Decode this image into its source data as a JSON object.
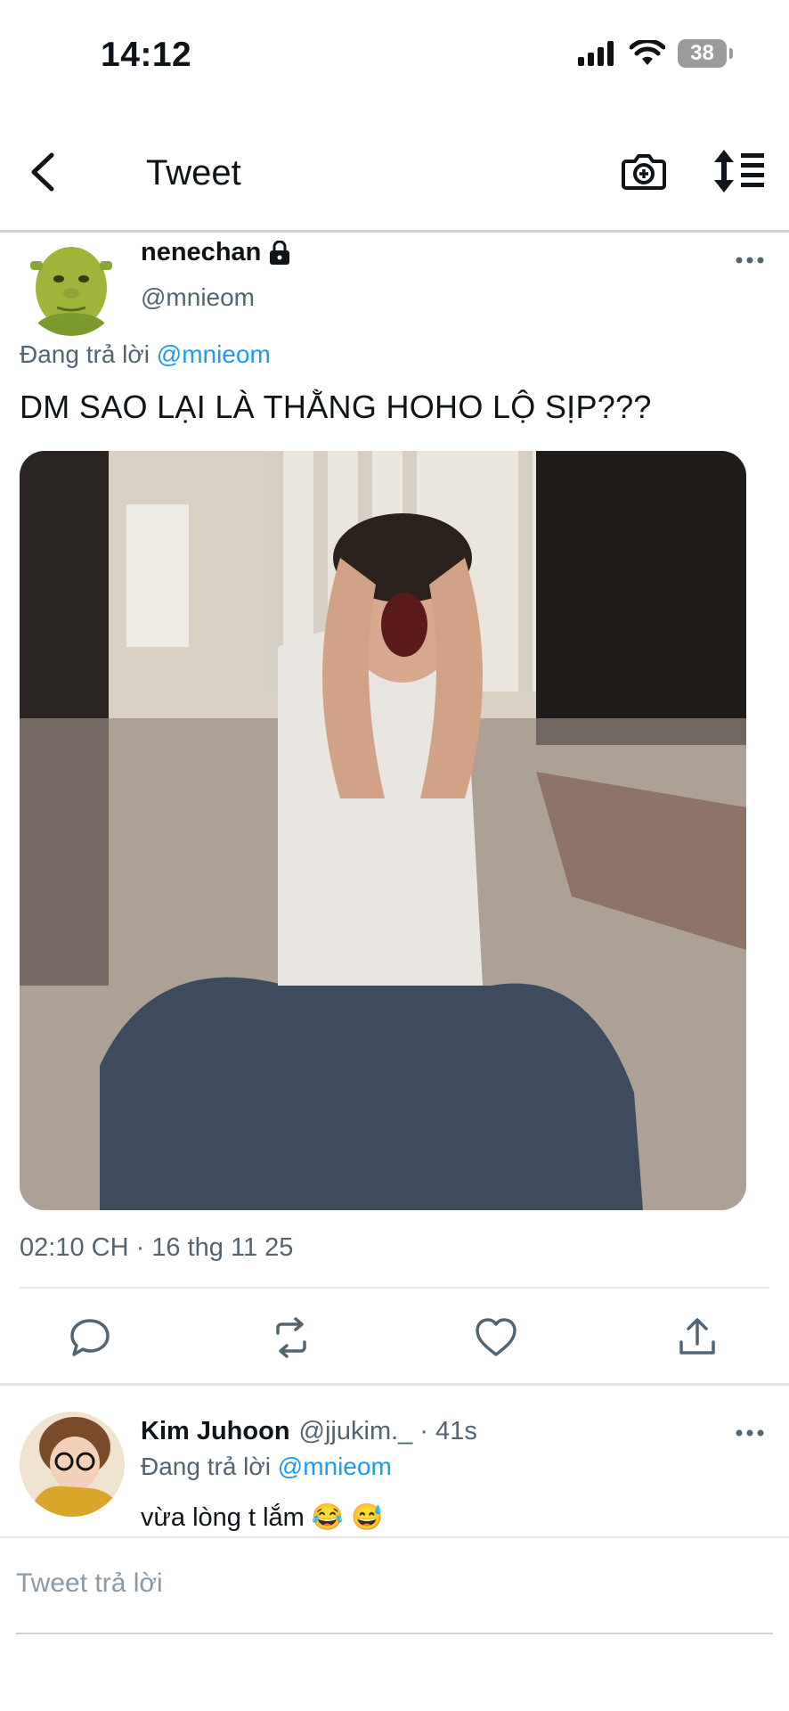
{
  "status_bar": {
    "time": "14:12",
    "battery": "38",
    "icons": [
      "signal-icon",
      "wifi-icon",
      "battery-icon"
    ]
  },
  "header": {
    "title": "Tweet",
    "icons": [
      "back-icon",
      "camera-add-icon",
      "sort-icon"
    ]
  },
  "tweet": {
    "name": "nenechan",
    "locked_icon": "lock-icon",
    "handle": "@mnieom",
    "reply_prefix": "Đang trả lời",
    "reply_handle": "@mnieom",
    "text": "DM SAO LẠI LÀ THẰNG HOHO LỘ SỊP???",
    "timestamp": "02:10 CH · 16 thg 11 25",
    "actions": [
      "reply-icon",
      "retweet-icon",
      "like-icon",
      "share-icon"
    ]
  },
  "reply": {
    "name": "Kim Juhoon",
    "handle_time": "@jjukim._ · 41s",
    "reply_prefix": "Đang trả lời",
    "reply_handle": "@mnieom",
    "text": "vừa lòng t lắm 😂 😅"
  },
  "composer": {
    "placeholder": "Tweet trả lời"
  },
  "colors": {
    "link": "#1d9bf0",
    "secondary_text": "#536471",
    "text": "#0f1419"
  }
}
